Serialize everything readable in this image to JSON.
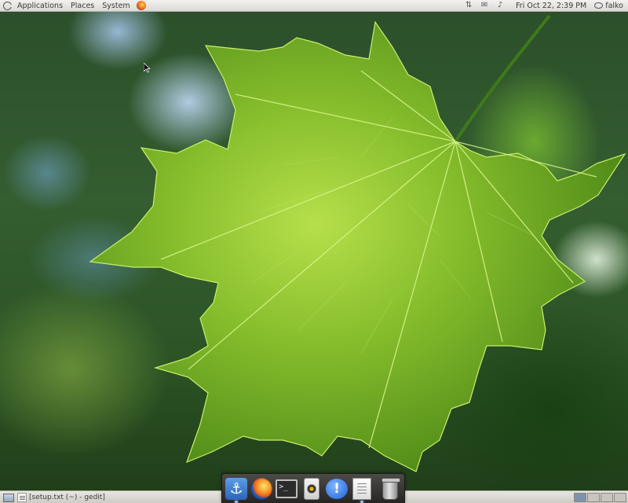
{
  "top_panel": {
    "menus": [
      "Applications",
      "Places",
      "System"
    ],
    "clock": "Fri Oct 22,  2:39 PM",
    "user": "falko"
  },
  "bottom_panel": {
    "task_title": "[setup.txt (~) - gedit]",
    "workspace_count": 4
  },
  "dock": {
    "items": [
      "anchor-icon",
      "firefox-icon",
      "terminal-icon",
      "speaker-icon",
      "chat-icon",
      "text-editor-icon",
      "trash-icon"
    ],
    "terminal_glyph": ">_",
    "chat_glyph": "!",
    "anchor_glyph": "⚓"
  },
  "colors": {
    "panel": "#dcdad5",
    "dock": "#2f2e2c",
    "leaf": "#8cc43a"
  }
}
